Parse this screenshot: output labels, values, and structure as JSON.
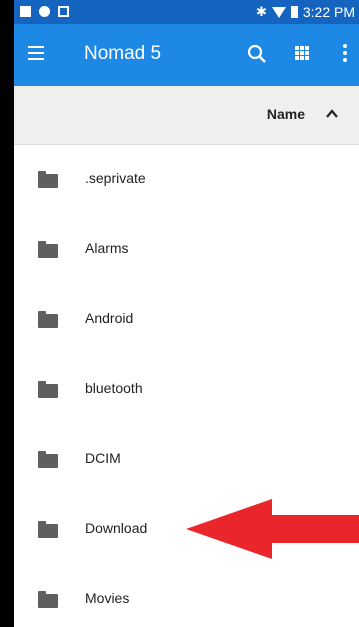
{
  "status_bar": {
    "time": "3:22 PM"
  },
  "app_bar": {
    "title": "Nomad 5"
  },
  "sort_bar": {
    "label": "Name"
  },
  "files": [
    {
      "name": ".seprivate"
    },
    {
      "name": "Alarms"
    },
    {
      "name": "Android"
    },
    {
      "name": "bluetooth"
    },
    {
      "name": "DCIM"
    },
    {
      "name": "Download"
    },
    {
      "name": "Movies"
    }
  ],
  "colors": {
    "status_bar": "#1565c0",
    "app_bar": "#1e88e5",
    "arrow": "#e8262b"
  },
  "icons": [
    "menu-icon",
    "search-icon",
    "grid-view-icon",
    "more-options-icon",
    "sort-ascending-icon",
    "folder-icon"
  ]
}
